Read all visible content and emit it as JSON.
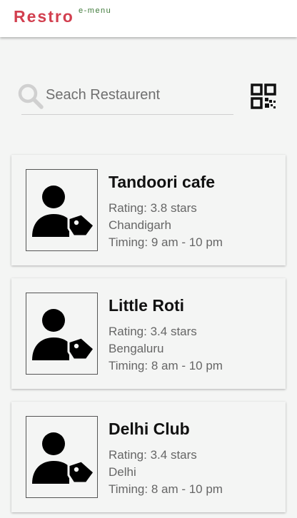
{
  "header": {
    "brand": "Restro",
    "brand_sup": "e-menu",
    "brand_color": "#d23f4f",
    "sup_color": "#3f7a3a"
  },
  "search": {
    "placeholder": "Seach Restaurent",
    "value": "",
    "icon": "search-icon"
  },
  "qr": {
    "icon": "qr-code-icon"
  },
  "restaurants": [
    {
      "name": "Tandoori cafe",
      "rating": "Rating: 3.8 stars",
      "city": "Chandigarh",
      "timing": "Timing: 9 am - 10 pm",
      "icon": "person-tag-icon"
    },
    {
      "name": "Little Roti",
      "rating": "Rating: 3.4 stars",
      "city": "Bengaluru",
      "timing": "Timing: 8 am - 10 pm",
      "icon": "person-tag-icon"
    },
    {
      "name": "Delhi Club",
      "rating": "Rating: 3.4 stars",
      "city": "Delhi",
      "timing": "Timing: 8 am - 10 pm",
      "icon": "person-tag-icon"
    }
  ]
}
